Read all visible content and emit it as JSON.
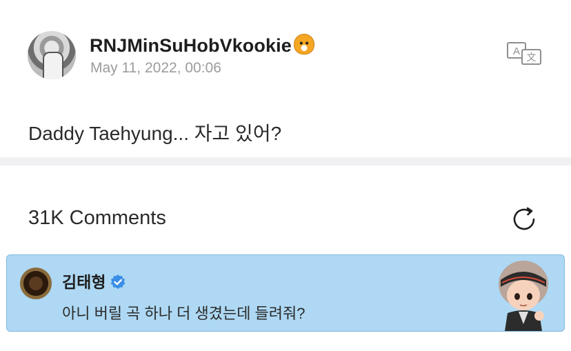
{
  "post": {
    "username": "RNJMinSuHobVkookie",
    "username_emoji_icon": "tiger-face-icon",
    "timestamp": "May 11, 2022, 00:06",
    "body": "Daddy Taehyung... 자고 있어?"
  },
  "translate_button": {
    "icon": "translate-icon"
  },
  "comments": {
    "title": "31K Comments",
    "refresh_icon": "refresh-icon"
  },
  "highlighted_comment": {
    "author": "김태형",
    "verified_icon": "verified-badge-icon",
    "text": "아니 버릴 곡 하나 더 생겼는데 들려줘?",
    "background_color": "#aed8f3"
  }
}
